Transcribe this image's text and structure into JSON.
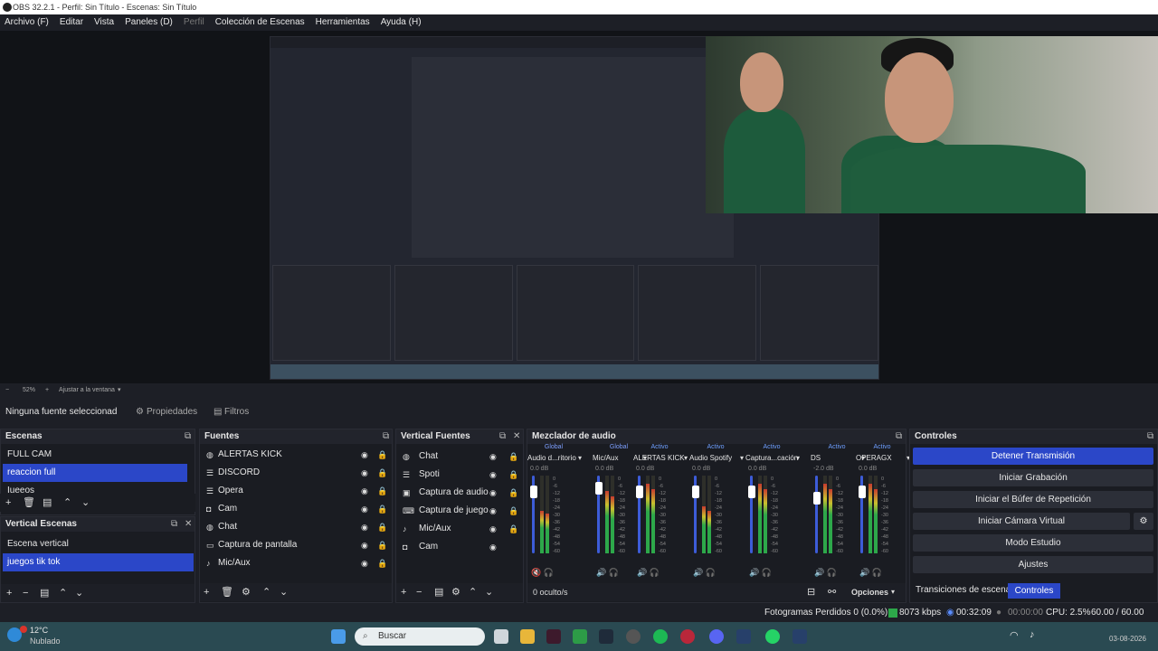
{
  "window": {
    "title": "OBS 32.2.1 - Perfil: Sin Título - Escenas: Sin Título"
  },
  "menu": {
    "items": [
      "Archivo (F)",
      "Editar",
      "Vista",
      "Paneles (D)",
      "Perfil",
      "Colección de Escenas",
      "Herramientas",
      "Ayuda (H)"
    ]
  },
  "zoom": {
    "level": "52%",
    "fit": "Ajustar a la ventana"
  },
  "properties_bar": {
    "no_source": "Ninguna fuente seleccionad",
    "properties": "Propiedades",
    "filters": "Filtros"
  },
  "scenes": {
    "title": "Escenas",
    "items": [
      "FULL CAM",
      "reaccion full",
      "Iueeos"
    ],
    "selected": 1
  },
  "vertical_scenes": {
    "title": "Vertical Escenas",
    "items": [
      "Escena vertical",
      "juegos tik tok"
    ],
    "selected": 1
  },
  "sources": {
    "title": "Fuentes",
    "items": [
      {
        "name": "ALERTAS KICK",
        "icon": "globe-icon"
      },
      {
        "name": "DISCORD",
        "icon": "list-icon"
      },
      {
        "name": "Opera",
        "icon": "list-icon"
      },
      {
        "name": "Cam",
        "icon": "camera-icon"
      },
      {
        "name": "Chat",
        "icon": "globe-icon"
      },
      {
        "name": "Captura de pantalla",
        "icon": "monitor-icon"
      },
      {
        "name": "Mic/Aux",
        "icon": "mic-icon"
      }
    ]
  },
  "vertical_sources": {
    "title": "Vertical Fuentes",
    "items": [
      {
        "name": "Chat",
        "icon": "globe-icon"
      },
      {
        "name": "Spoti",
        "icon": "list-icon"
      },
      {
        "name": "Captura de audio",
        "icon": "audio-capture-icon"
      },
      {
        "name": "Captura de juego",
        "icon": "gamepad-icon"
      },
      {
        "name": "Mic/Aux",
        "icon": "mic-icon"
      },
      {
        "name": "Cam",
        "icon": "camera-icon"
      }
    ]
  },
  "mixer": {
    "title": "Mezclador de audio",
    "hidden": "0 oculto/s",
    "options": "Opciones",
    "channels": [
      {
        "tag": "Global",
        "name": "Audio d...ritorio",
        "db": "0.0 dB",
        "level": 0.85,
        "meter": 0.55,
        "tag_color": "#7ea0ff",
        "muted": true
      },
      {
        "tag": "Global",
        "name": "Mic/Aux",
        "db": "0.0 dB",
        "level": 0.9,
        "meter": 0.8,
        "tag_color": "#7ea0ff",
        "muted": false
      },
      {
        "tag": "Activo",
        "name": "ALERTAS KICK",
        "db": "0.0 dB",
        "level": 0.85,
        "meter": 0.9,
        "tag_color": "#6fa0ff",
        "muted": false
      },
      {
        "tag": "Activo",
        "name": "Audio Spotify",
        "db": "0.0 dB",
        "level": 0.85,
        "meter": 0.6,
        "tag_color": "#6fa0ff",
        "muted": false
      },
      {
        "tag": "Activo",
        "name": "Captura...cación",
        "db": "0.0 dB",
        "level": 0.85,
        "meter": 0.9,
        "tag_color": "#6fa0ff",
        "muted": false
      },
      {
        "tag": "Activo",
        "name": "DS",
        "db": "-2.0 dB",
        "level": 0.75,
        "meter": 0.9,
        "tag_color": "#6fa0ff",
        "muted": false
      },
      {
        "tag": "Activo",
        "name": "OPERAGX",
        "db": "0.0 dB",
        "level": 0.85,
        "meter": 0.9,
        "tag_color": "#6fa0ff",
        "muted": false
      }
    ],
    "scale": [
      "0",
      "-6",
      "-12",
      "-18",
      "-24",
      "-30",
      "-36",
      "-42",
      "-48",
      "-54",
      "-60"
    ]
  },
  "controls": {
    "title": "Controles",
    "buttons": [
      "Detener Transmisión",
      "Iniciar Grabación",
      "Iniciar el Búfer de Repetición",
      "Iniciar Cámara Virtual",
      "Modo Estudio",
      "Ajustes"
    ],
    "tabs": [
      "Transiciones de escena",
      "Controles"
    ]
  },
  "status": {
    "dropped": "Fotogramas Perdidos 0 (0.0%)",
    "bitrate": "8073 kbps",
    "stream_time": "00:32:09",
    "rec_time": "00:00:00",
    "cpu": "CPU: 2.5%",
    "fps": "60.00 / 60.00 FPS"
  },
  "taskbar": {
    "weather_temp": "12°C",
    "weather_desc": "Nublado",
    "search": "Buscar",
    "date": "03-08-2026"
  }
}
